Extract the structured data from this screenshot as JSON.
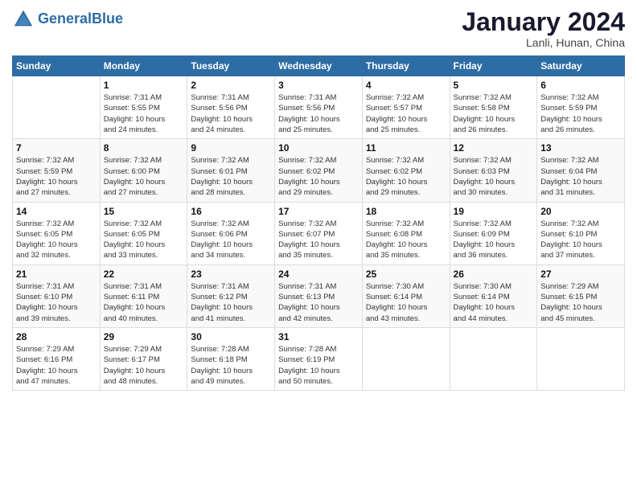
{
  "header": {
    "logo_line1": "General",
    "logo_line2": "Blue",
    "month": "January 2024",
    "location": "Lanli, Hunan, China"
  },
  "weekdays": [
    "Sunday",
    "Monday",
    "Tuesday",
    "Wednesday",
    "Thursday",
    "Friday",
    "Saturday"
  ],
  "weeks": [
    [
      {
        "day": "",
        "info": ""
      },
      {
        "day": "1",
        "info": "Sunrise: 7:31 AM\nSunset: 5:55 PM\nDaylight: 10 hours\nand 24 minutes."
      },
      {
        "day": "2",
        "info": "Sunrise: 7:31 AM\nSunset: 5:56 PM\nDaylight: 10 hours\nand 24 minutes."
      },
      {
        "day": "3",
        "info": "Sunrise: 7:31 AM\nSunset: 5:56 PM\nDaylight: 10 hours\nand 25 minutes."
      },
      {
        "day": "4",
        "info": "Sunrise: 7:32 AM\nSunset: 5:57 PM\nDaylight: 10 hours\nand 25 minutes."
      },
      {
        "day": "5",
        "info": "Sunrise: 7:32 AM\nSunset: 5:58 PM\nDaylight: 10 hours\nand 26 minutes."
      },
      {
        "day": "6",
        "info": "Sunrise: 7:32 AM\nSunset: 5:59 PM\nDaylight: 10 hours\nand 26 minutes."
      }
    ],
    [
      {
        "day": "7",
        "info": "Sunrise: 7:32 AM\nSunset: 5:59 PM\nDaylight: 10 hours\nand 27 minutes."
      },
      {
        "day": "8",
        "info": "Sunrise: 7:32 AM\nSunset: 6:00 PM\nDaylight: 10 hours\nand 27 minutes."
      },
      {
        "day": "9",
        "info": "Sunrise: 7:32 AM\nSunset: 6:01 PM\nDaylight: 10 hours\nand 28 minutes."
      },
      {
        "day": "10",
        "info": "Sunrise: 7:32 AM\nSunset: 6:02 PM\nDaylight: 10 hours\nand 29 minutes."
      },
      {
        "day": "11",
        "info": "Sunrise: 7:32 AM\nSunset: 6:02 PM\nDaylight: 10 hours\nand 29 minutes."
      },
      {
        "day": "12",
        "info": "Sunrise: 7:32 AM\nSunset: 6:03 PM\nDaylight: 10 hours\nand 30 minutes."
      },
      {
        "day": "13",
        "info": "Sunrise: 7:32 AM\nSunset: 6:04 PM\nDaylight: 10 hours\nand 31 minutes."
      }
    ],
    [
      {
        "day": "14",
        "info": "Sunrise: 7:32 AM\nSunset: 6:05 PM\nDaylight: 10 hours\nand 32 minutes."
      },
      {
        "day": "15",
        "info": "Sunrise: 7:32 AM\nSunset: 6:05 PM\nDaylight: 10 hours\nand 33 minutes."
      },
      {
        "day": "16",
        "info": "Sunrise: 7:32 AM\nSunset: 6:06 PM\nDaylight: 10 hours\nand 34 minutes."
      },
      {
        "day": "17",
        "info": "Sunrise: 7:32 AM\nSunset: 6:07 PM\nDaylight: 10 hours\nand 35 minutes."
      },
      {
        "day": "18",
        "info": "Sunrise: 7:32 AM\nSunset: 6:08 PM\nDaylight: 10 hours\nand 35 minutes."
      },
      {
        "day": "19",
        "info": "Sunrise: 7:32 AM\nSunset: 6:09 PM\nDaylight: 10 hours\nand 36 minutes."
      },
      {
        "day": "20",
        "info": "Sunrise: 7:32 AM\nSunset: 6:10 PM\nDaylight: 10 hours\nand 37 minutes."
      }
    ],
    [
      {
        "day": "21",
        "info": "Sunrise: 7:31 AM\nSunset: 6:10 PM\nDaylight: 10 hours\nand 39 minutes."
      },
      {
        "day": "22",
        "info": "Sunrise: 7:31 AM\nSunset: 6:11 PM\nDaylight: 10 hours\nand 40 minutes."
      },
      {
        "day": "23",
        "info": "Sunrise: 7:31 AM\nSunset: 6:12 PM\nDaylight: 10 hours\nand 41 minutes."
      },
      {
        "day": "24",
        "info": "Sunrise: 7:31 AM\nSunset: 6:13 PM\nDaylight: 10 hours\nand 42 minutes."
      },
      {
        "day": "25",
        "info": "Sunrise: 7:30 AM\nSunset: 6:14 PM\nDaylight: 10 hours\nand 43 minutes."
      },
      {
        "day": "26",
        "info": "Sunrise: 7:30 AM\nSunset: 6:14 PM\nDaylight: 10 hours\nand 44 minutes."
      },
      {
        "day": "27",
        "info": "Sunrise: 7:29 AM\nSunset: 6:15 PM\nDaylight: 10 hours\nand 45 minutes."
      }
    ],
    [
      {
        "day": "28",
        "info": "Sunrise: 7:29 AM\nSunset: 6:16 PM\nDaylight: 10 hours\nand 47 minutes."
      },
      {
        "day": "29",
        "info": "Sunrise: 7:29 AM\nSunset: 6:17 PM\nDaylight: 10 hours\nand 48 minutes."
      },
      {
        "day": "30",
        "info": "Sunrise: 7:28 AM\nSunset: 6:18 PM\nDaylight: 10 hours\nand 49 minutes."
      },
      {
        "day": "31",
        "info": "Sunrise: 7:28 AM\nSunset: 6:19 PM\nDaylight: 10 hours\nand 50 minutes."
      },
      {
        "day": "",
        "info": ""
      },
      {
        "day": "",
        "info": ""
      },
      {
        "day": "",
        "info": ""
      }
    ]
  ]
}
